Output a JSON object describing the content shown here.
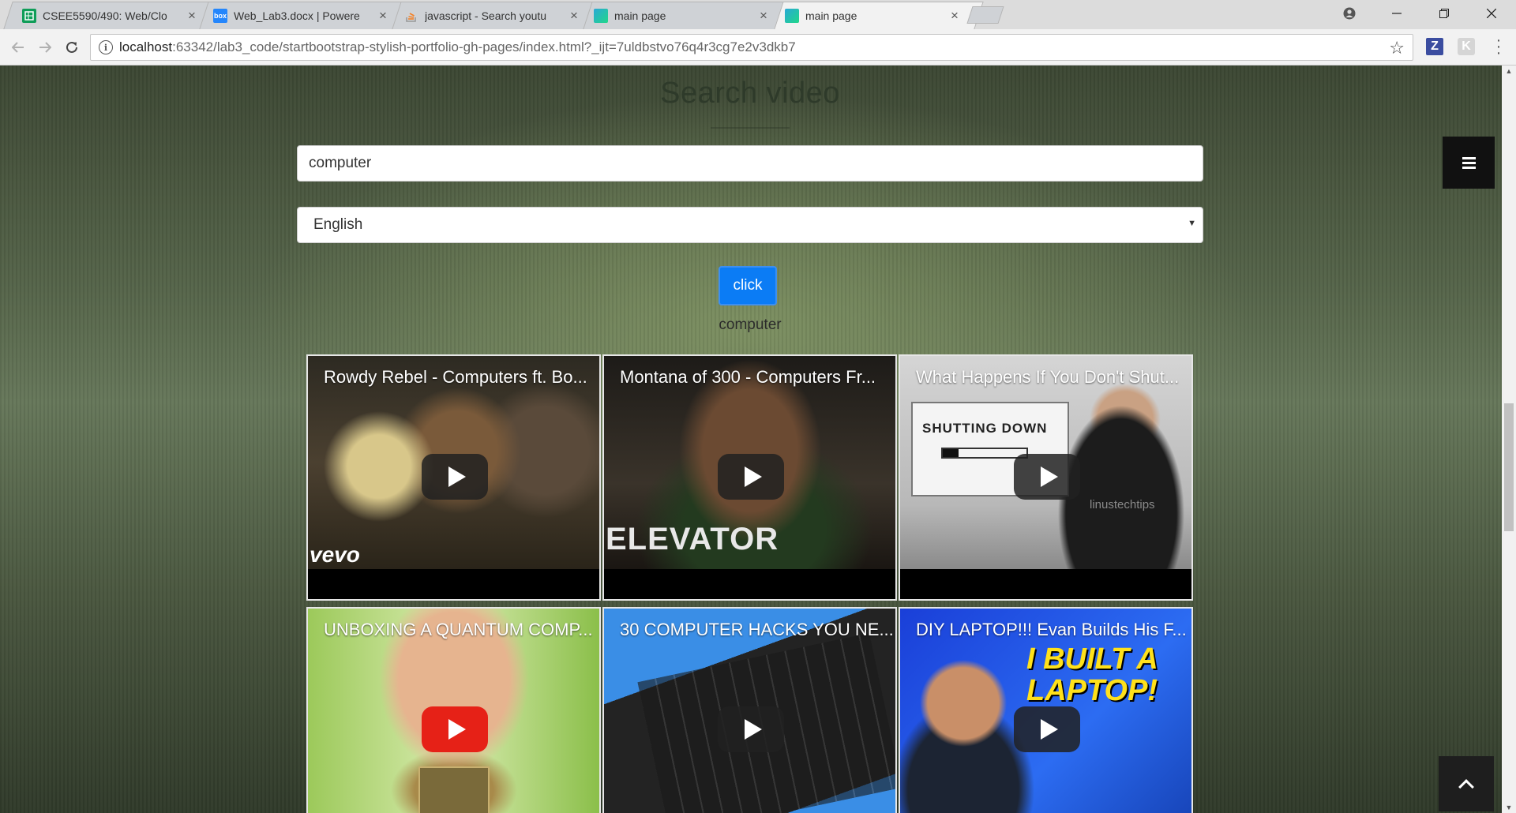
{
  "browser": {
    "tabs": [
      {
        "title": "CSEE5590/490: Web/Clo",
        "favicon": "sheets-icon",
        "color": "#0f9d58",
        "active": false
      },
      {
        "title": "Web_Lab3.docx | Powere",
        "favicon": "box-icon",
        "color": "#2486fc",
        "active": false
      },
      {
        "title": "javascript - Search youtu",
        "favicon": "stackoverflow-icon",
        "color": "#f48024",
        "active": false
      },
      {
        "title": "main page",
        "favicon": "webstorm-icon",
        "color": "#2aa9d6",
        "active": false
      },
      {
        "title": "main page",
        "favicon": "webstorm-icon",
        "color": "#2aa9d6",
        "active": true
      }
    ],
    "url_host": "localhost",
    "url_rest": ":63342/lab3_code/startbootstrap-stylish-portfolio-gh-pages/index.html?_ijt=7uldbstvo76q4r3cg7e2v3dkb7",
    "extension_z": "Z",
    "extension_k": "K"
  },
  "page": {
    "title": "Search video",
    "search_value": "computer",
    "language_selected": "English",
    "button_label": "click",
    "query_echo": "computer"
  },
  "videos": [
    {
      "title": "Rowdy Rebel - Computers ft. Bo...",
      "brand": "vevo",
      "play_style": "dark"
    },
    {
      "title": "Montana of 300 - Computers Fr...",
      "brand": "ELEVATOR",
      "play_style": "dark"
    },
    {
      "title": "What Happens If You Don't Shut...",
      "brand": "SHUTTING DOWN",
      "brand2": "linustechtips",
      "play_style": "dark"
    },
    {
      "title": "UNBOXING A QUANTUM COMP...",
      "play_style": "red"
    },
    {
      "title": "30 COMPUTER HACKS YOU NE...",
      "play_style": "dark"
    },
    {
      "title": "DIY LAPTOP!!! Evan Builds His F...",
      "brand": "I BUILT A LAPTOP!",
      "play_style": "dark"
    }
  ],
  "colors": {
    "primary_button": "#0b7cf5",
    "youtube_red": "#e62117"
  }
}
